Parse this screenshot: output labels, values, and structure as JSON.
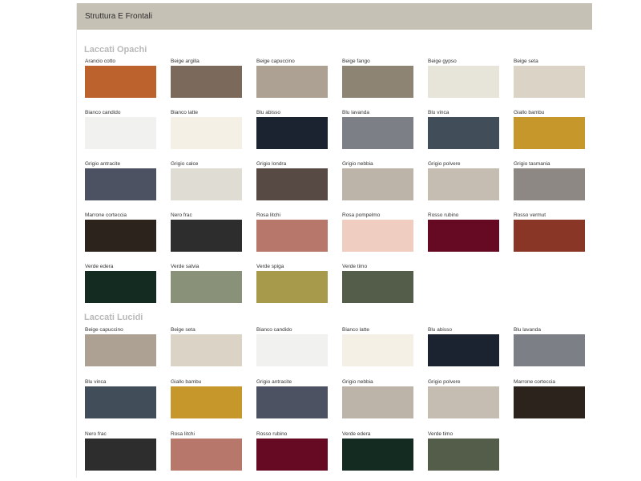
{
  "header": {
    "title": "Struttura E Frontali"
  },
  "sections": {
    "opachi": {
      "title": "Laccati Opachi",
      "items": [
        {
          "label": "Arancio cotto",
          "color": "#bc622d"
        },
        {
          "label": "Beige argilla",
          "color": "#7b6a5b"
        },
        {
          "label": "Beige capuccino",
          "color": "#ada193"
        },
        {
          "label": "Beige fango",
          "color": "#8e8474"
        },
        {
          "label": "Beige gypso",
          "color": "#e7e4da"
        },
        {
          "label": "Beige seta",
          "color": "#dad3c6"
        },
        {
          "label": "Bianco candido",
          "color": "#f1f1ef"
        },
        {
          "label": "Bianco latte",
          "color": "#f4f0e6"
        },
        {
          "label": "Blu abisso",
          "color": "#1b2330"
        },
        {
          "label": "Blu lavanda",
          "color": "#7c8086"
        },
        {
          "label": "Blu vinca",
          "color": "#424d5a"
        },
        {
          "label": "Giallo bambu",
          "color": "#c6972a"
        },
        {
          "label": "Grigio antracite",
          "color": "#4d5262"
        },
        {
          "label": "Grigio calce",
          "color": "#dedcd3"
        },
        {
          "label": "Grigio londra",
          "color": "#574a45"
        },
        {
          "label": "Grigio nebbia",
          "color": "#bdb4a9"
        },
        {
          "label": "Grigio polvere",
          "color": "#c6bdb2"
        },
        {
          "label": "Grigio tasmania",
          "color": "#8e8885"
        },
        {
          "label": "Marrone corteccia",
          "color": "#2d231d"
        },
        {
          "label": "Nero frac",
          "color": "#2d2d2d"
        },
        {
          "label": "Rosa litchi",
          "color": "#b7776a"
        },
        {
          "label": "Rosa pompelmo",
          "color": "#efcec1"
        },
        {
          "label": "Rosso rubino",
          "color": "#660a24"
        },
        {
          "label": "Rosso vermut",
          "color": "#8a3627"
        },
        {
          "label": "Verde edera",
          "color": "#132b21"
        },
        {
          "label": "Verde salvia",
          "color": "#8a9179"
        },
        {
          "label": "Verde spiga",
          "color": "#a89a4b"
        },
        {
          "label": "Verde timo",
          "color": "#545c4a"
        }
      ]
    },
    "lucidi": {
      "title": "Laccati Lucidi",
      "items": [
        {
          "label": "Beige capuccino",
          "color": "#ada193"
        },
        {
          "label": "Beige seta",
          "color": "#dad3c6"
        },
        {
          "label": "Bianco candido",
          "color": "#f1f1ef"
        },
        {
          "label": "Bianco latte",
          "color": "#f4f0e6"
        },
        {
          "label": "Blu abisso",
          "color": "#1b2330"
        },
        {
          "label": "Blu lavanda",
          "color": "#7c8086"
        },
        {
          "label": "Blu vinca",
          "color": "#424d5a"
        },
        {
          "label": "Giallo bambu",
          "color": "#c6972a"
        },
        {
          "label": "Grigio antracite",
          "color": "#4d5262"
        },
        {
          "label": "Grigio nebbia",
          "color": "#bdb4a9"
        },
        {
          "label": "Grigio polvere",
          "color": "#c6bdb2"
        },
        {
          "label": "Marrone corteccia",
          "color": "#2d231d"
        },
        {
          "label": "Nero frac",
          "color": "#2d2d2d"
        },
        {
          "label": "Rosa litchi",
          "color": "#b7776a"
        },
        {
          "label": "Rosso rubino",
          "color": "#660a24"
        },
        {
          "label": "Verde edera",
          "color": "#132b21"
        },
        {
          "label": "Verde timo",
          "color": "#545c4a"
        }
      ]
    }
  }
}
